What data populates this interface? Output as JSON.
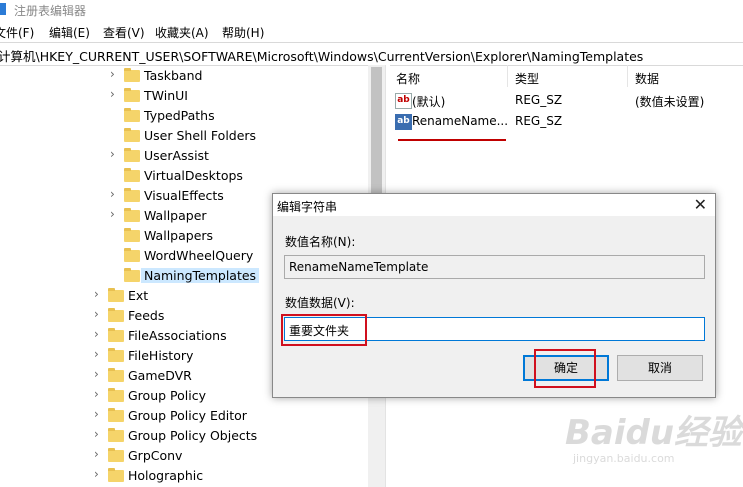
{
  "window": {
    "title": "注册表编辑器"
  },
  "menu": [
    "文件(F)",
    "编辑(E)",
    "查看(V)",
    "收藏夹(A)",
    "帮助(H)"
  ],
  "address": "计算机\\HKEY_CURRENT_USER\\SOFTWARE\\Microsoft\\Windows\\CurrentVersion\\Explorer\\NamingTemplates",
  "tree": {
    "items": [
      {
        "label": "Taskband",
        "expandable": true,
        "level": 2
      },
      {
        "label": "TWinUI",
        "expandable": true,
        "level": 2
      },
      {
        "label": "TypedPaths",
        "expandable": false,
        "level": 2
      },
      {
        "label": "User Shell Folders",
        "expandable": false,
        "level": 2
      },
      {
        "label": "UserAssist",
        "expandable": true,
        "level": 2
      },
      {
        "label": "VirtualDesktops",
        "expandable": false,
        "level": 2
      },
      {
        "label": "VisualEffects",
        "expandable": true,
        "level": 2
      },
      {
        "label": "Wallpaper",
        "expandable": true,
        "level": 2
      },
      {
        "label": "Wallpapers",
        "expandable": false,
        "level": 2
      },
      {
        "label": "WordWheelQuery",
        "expandable": false,
        "level": 2
      },
      {
        "label": "NamingTemplates",
        "expandable": false,
        "level": 2,
        "selected": true
      },
      {
        "label": "Ext",
        "expandable": true,
        "level": 1
      },
      {
        "label": "Feeds",
        "expandable": true,
        "level": 1
      },
      {
        "label": "FileAssociations",
        "expandable": true,
        "level": 1
      },
      {
        "label": "FileHistory",
        "expandable": true,
        "level": 1
      },
      {
        "label": "GameDVR",
        "expandable": true,
        "level": 1
      },
      {
        "label": "Group Policy",
        "expandable": true,
        "level": 1
      },
      {
        "label": "Group Policy Editor",
        "expandable": true,
        "level": 1
      },
      {
        "label": "Group Policy Objects",
        "expandable": true,
        "level": 1
      },
      {
        "label": "GrpConv",
        "expandable": true,
        "level": 1
      },
      {
        "label": "Holographic",
        "expandable": true,
        "level": 1
      }
    ]
  },
  "list": {
    "columns": {
      "name": "名称",
      "type": "类型",
      "data": "数据"
    },
    "rows": [
      {
        "icon": "ab",
        "name": "(默认)",
        "type": "REG_SZ",
        "data": "(数值未设置)"
      },
      {
        "icon": "ab",
        "name": "RenameName...",
        "type": "REG_SZ",
        "data": ""
      }
    ]
  },
  "dialog": {
    "title": "编辑字符串",
    "close_glyph": "✕",
    "value_name_label": "数值名称(N):",
    "value_name": "RenameNameTemplate",
    "value_data_label": "数值数据(V):",
    "value_data": "重要文件夹",
    "ok_label": "确定",
    "cancel_label": "取消"
  },
  "watermark": {
    "brand": "Baidu经验",
    "url": "jingyan.baidu.com"
  },
  "colors": {
    "accent": "#0078d7",
    "highlight": "#d0101e",
    "selection": "#cce8ff",
    "folder": "#f5d46a"
  }
}
